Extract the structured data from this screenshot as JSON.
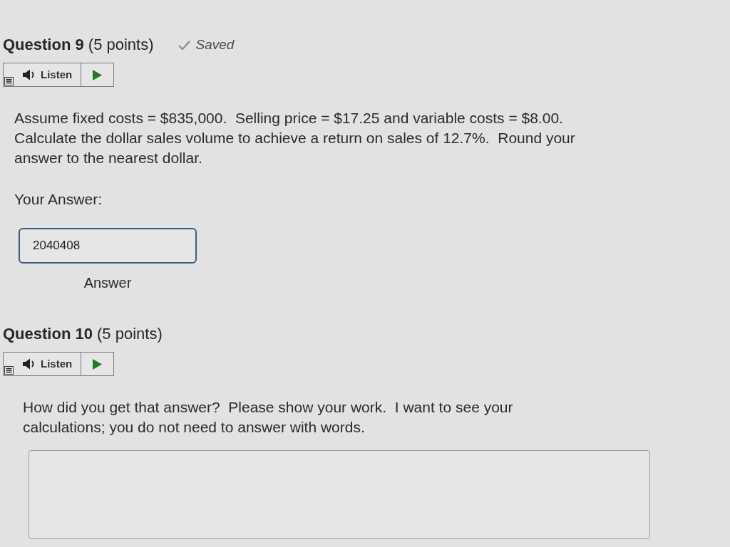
{
  "questions": [
    {
      "title": "**Question 9** (5 points)",
      "status": {
        "label": "Saved"
      },
      "listen": {
        "label": "Listen"
      },
      "prompt": [
        "Assume fixed costs = $835,000.  Selling price = $17.25 and variable costs = $8.00.",
        "Calculate the dollar sales volume to achieve a return on sales of 12.7%.  Round your",
        "answer to the nearest dollar."
      ],
      "answer_label": "Your Answer:",
      "answer": {
        "kind": "short",
        "value": "2040408",
        "caption": "Answer"
      }
    },
    {
      "title": "**Question 10** (5 points)",
      "listen": {
        "label": "Listen"
      },
      "prompt": [
        "How did you get that answer?  Please show your work.  I want to see your",
        "calculations; you do not need to answer with words."
      ],
      "answer": {
        "kind": "essay"
      }
    }
  ]
}
